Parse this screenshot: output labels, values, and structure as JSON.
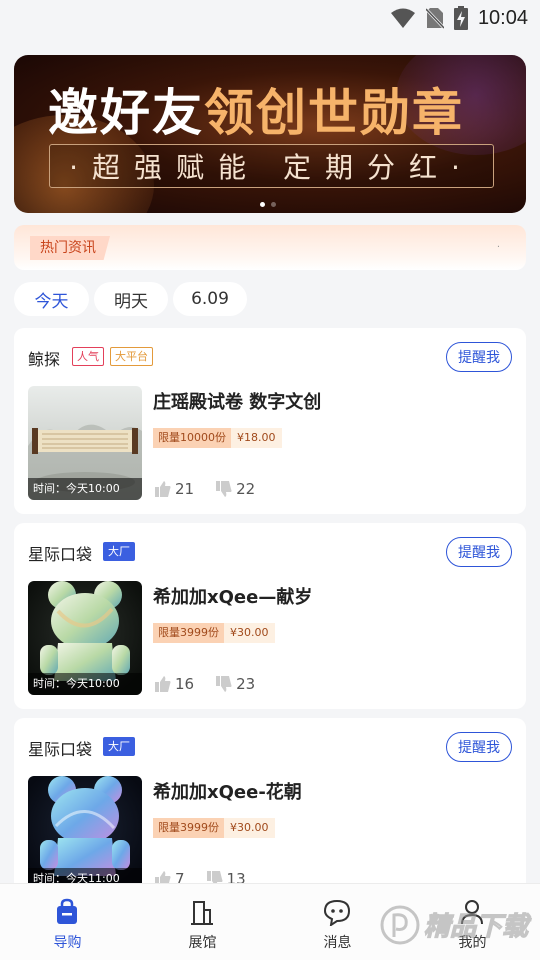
{
  "status_bar": {
    "time": "10:04",
    "icons": [
      "wifi-icon",
      "no-sim-icon",
      "battery-charging-icon"
    ]
  },
  "banner": {
    "title_part1": "邀好友",
    "title_part2": "领创世勋章",
    "subtitle": "·超强赋能 定期分红·",
    "slide_count": 2,
    "active_slide": 1
  },
  "news": {
    "tag": "热门资讯",
    "marquee": "."
  },
  "date_tabs": [
    {
      "label": "今天",
      "active": true
    },
    {
      "label": "明天",
      "active": false
    },
    {
      "label": "6.09",
      "active": false
    }
  ],
  "cards": [
    {
      "shop": "鲸探",
      "badges": [
        {
          "text": "人气",
          "style": "red"
        },
        {
          "text": "大平台",
          "style": "orange"
        }
      ],
      "remind": "提醒我",
      "title": "庄瑶殿试卷 数字文创",
      "limit": "限量10000份",
      "price": "¥18.00",
      "time": "时间：今天10:00",
      "likes": "21",
      "dislikes": "22"
    },
    {
      "shop": "星际口袋",
      "badges": [
        {
          "text": "大厂",
          "style": "blue"
        }
      ],
      "remind": "提醒我",
      "title": "希加加xQee—献岁",
      "limit": "限量3999份",
      "price": "¥30.00",
      "time": "时间：今天10:00",
      "likes": "16",
      "dislikes": "23"
    },
    {
      "shop": "星际口袋",
      "badges": [
        {
          "text": "大厂",
          "style": "blue"
        }
      ],
      "remind": "提醒我",
      "title": "希加加xQee-花朝",
      "limit": "限量3999份",
      "price": "¥30.00",
      "time": "时间：今天11:00",
      "likes": "7",
      "dislikes": "13"
    }
  ],
  "bottom_nav": [
    {
      "label": "导购",
      "icon": "shopping-bag-icon",
      "active": true
    },
    {
      "label": "展馆",
      "icon": "building-icon",
      "active": false
    },
    {
      "label": "消息",
      "icon": "chat-bubble-icon",
      "active": false
    },
    {
      "label": "我的",
      "icon": "profile-icon",
      "active": false
    }
  ],
  "watermark": {
    "text": "精品下载"
  },
  "colors": {
    "accent": "#2e55d8",
    "badge_blue": "#3b5fe0",
    "hot_tag": "#c9451d",
    "price_tag_bg": "#fbd2b4"
  }
}
